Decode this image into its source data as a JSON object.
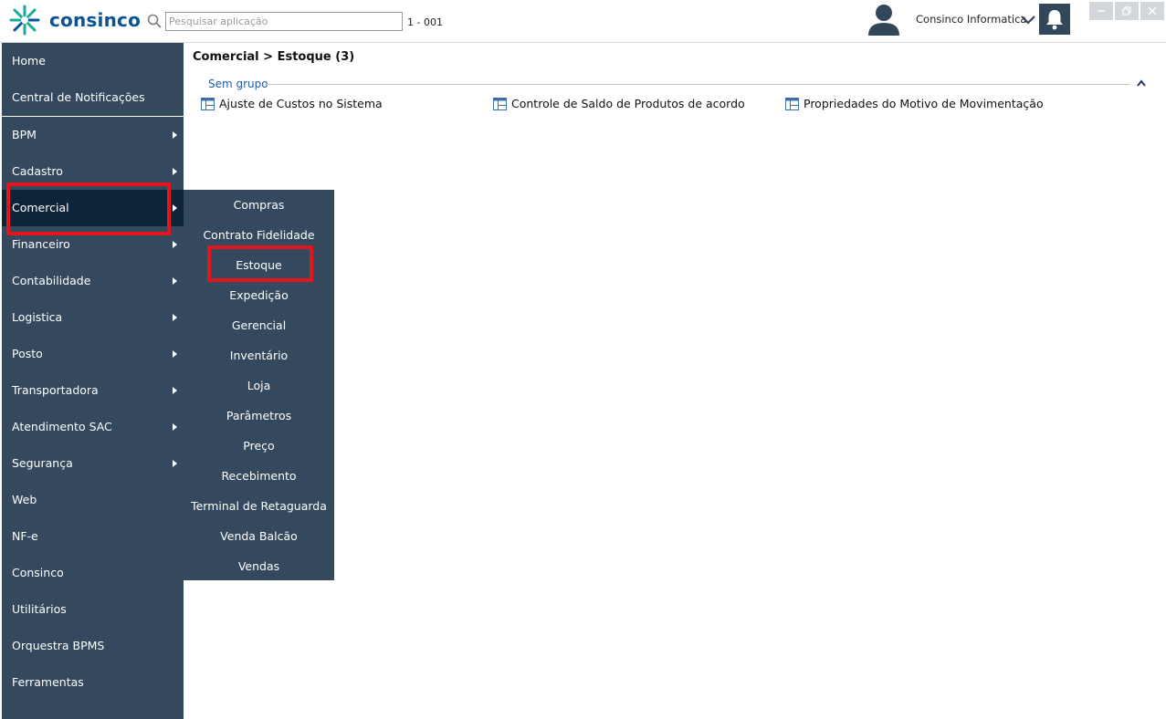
{
  "header": {
    "brand": "consinco",
    "search_placeholder": "Pesquisar aplicação",
    "code": "1 - 001",
    "user_name": "Consinco Informatica"
  },
  "sidebar": {
    "items": [
      {
        "label": "Home",
        "arrow": false
      },
      {
        "label": "Central de Notificações",
        "arrow": false
      },
      {
        "label": "BPM",
        "arrow": true
      },
      {
        "label": "Cadastro",
        "arrow": true
      },
      {
        "label": "Comercial",
        "arrow": true,
        "active": true
      },
      {
        "label": "Financeiro",
        "arrow": true
      },
      {
        "label": "Contabilidade",
        "arrow": true
      },
      {
        "label": "Logistica",
        "arrow": true
      },
      {
        "label": "Posto",
        "arrow": true
      },
      {
        "label": "Transportadora",
        "arrow": true
      },
      {
        "label": "Atendimento SAC",
        "arrow": true
      },
      {
        "label": "Segurança",
        "arrow": true
      },
      {
        "label": "Web",
        "arrow": false
      },
      {
        "label": "NF-e",
        "arrow": false
      },
      {
        "label": "Consinco",
        "arrow": false
      },
      {
        "label": "Utilitários",
        "arrow": false
      },
      {
        "label": "Orquestra BPMS",
        "arrow": false
      },
      {
        "label": "Ferramentas",
        "arrow": false
      }
    ]
  },
  "submenu": {
    "items": [
      "Compras",
      "Contrato Fidelidade",
      "Estoque",
      "Expedição",
      "Gerencial",
      "Inventário",
      "Loja",
      "Parâmetros",
      "Preço",
      "Recebimento",
      "Terminal de Retaguarda",
      "Venda Balcão",
      "Vendas"
    ]
  },
  "main": {
    "breadcrumb": "Comercial > Estoque (3)",
    "group_label": "Sem grupo",
    "apps": [
      "Ajuste de Custos no Sistema",
      "Controle de Saldo de Produtos de acordo",
      "Propriedades do Motivo de Movimentação"
    ]
  },
  "colors": {
    "sidebar_bg": "#34495e",
    "sidebar_active": "#0e2439",
    "brand_blue": "#0b5394",
    "highlight_red": "#e3141b",
    "group_blue": "#1f5fa8"
  }
}
